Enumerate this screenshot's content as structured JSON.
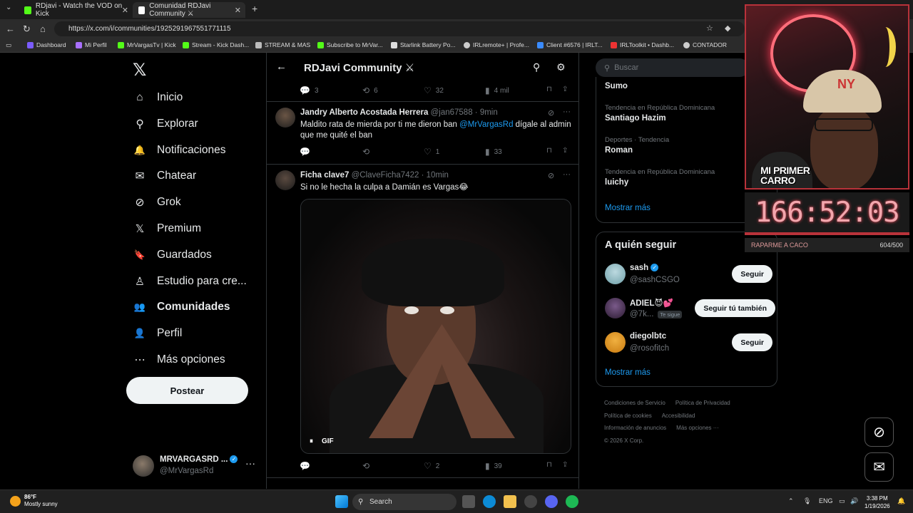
{
  "browser": {
    "tabs": [
      {
        "title": "RDjavi - Watch the VOD on Kick",
        "color": "#53fc18"
      },
      {
        "title": "Comunidad RDJavi Community ⚔",
        "color": "#ffffff"
      }
    ],
    "url": "https://x.com/i/communities/1925291967551771115",
    "bookmarks": [
      {
        "label": "Dashboard",
        "color": "#7b5cff"
      },
      {
        "label": "Mi Perfil",
        "color": "#a970ff"
      },
      {
        "label": "MrVargasTv | Kick",
        "color": "#53fc18"
      },
      {
        "label": "Stream - Kick Dash...",
        "color": "#53fc18"
      },
      {
        "label": "STREAM & MAS",
        "color": "#bbbbbb"
      },
      {
        "label": "Subscribe to MrVar...",
        "color": "#53fc18"
      },
      {
        "label": "Starlink Battery Po...",
        "color": "#dddddd"
      },
      {
        "label": "IRLremote+ | Profe...",
        "color": "#cccccc"
      },
      {
        "label": "Client #6576 | IRLT...",
        "color": "#3a8bff"
      },
      {
        "label": "IRLToolkit • Dashb...",
        "color": "#e33"
      },
      {
        "label": "CONTADOR",
        "color": "#cccccc"
      }
    ]
  },
  "sidebar": {
    "logo": "𝕏",
    "items": [
      {
        "label": "Inicio",
        "icon": "home-icon",
        "glyph": "⌂"
      },
      {
        "label": "Explorar",
        "icon": "search-icon",
        "glyph": "⚲"
      },
      {
        "label": "Notificaciones",
        "icon": "bell-icon",
        "glyph": "🔔"
      },
      {
        "label": "Chatear",
        "icon": "mail-icon",
        "glyph": "✉"
      },
      {
        "label": "Grok",
        "icon": "grok-icon",
        "glyph": "⊘"
      },
      {
        "label": "Premium",
        "icon": "x-icon",
        "glyph": "𝕏"
      },
      {
        "label": "Guardados",
        "icon": "bookmark-icon",
        "glyph": "🔖"
      },
      {
        "label": "Estudio para cre...",
        "icon": "studio-icon",
        "glyph": "♙"
      },
      {
        "label": "Comunidades",
        "icon": "communities-icon",
        "glyph": "👥"
      },
      {
        "label": "Perfil",
        "icon": "profile-icon",
        "glyph": "👤"
      },
      {
        "label": "Más opciones",
        "icon": "more-icon",
        "glyph": "⋯"
      }
    ],
    "post_button": "Postear",
    "account": {
      "name": "MRVARGASRD ...",
      "handle": "@MrVargasRd"
    }
  },
  "timeline": {
    "title": "RDJavi Community ⚔",
    "top_actions": {
      "replies": "3",
      "reposts": "6",
      "likes": "32",
      "views": "4 mil"
    },
    "posts": [
      {
        "name": "Jandry Alberto Acostada Herrera",
        "handle": "@jan67588",
        "time": "· 9min",
        "text_before": "Maldito rata de mierda por ti me dieron ban ",
        "mention": "@MrVargasRd",
        "text_after": " dígale al admin que me quité el ban",
        "replies": "",
        "reposts": "",
        "likes": "1",
        "views": "33"
      },
      {
        "name": "Ficha clave7",
        "handle": "@ClaveFicha7422",
        "time": "· 10min",
        "text": "Si no le hecha la culpa a Damián es Vargas😂",
        "media_label": "GIF",
        "replies": "",
        "reposts": "",
        "likes": "2",
        "views": "39"
      }
    ]
  },
  "right": {
    "search_placeholder": "Buscar",
    "trends": [
      {
        "category": "",
        "name": "Sumo"
      },
      {
        "category": "Tendencia en República Dominicana",
        "name": "Santiago Hazim"
      },
      {
        "category": "Deportes · Tendencia",
        "name": "Roman"
      },
      {
        "category": "Tendencia en República Dominicana",
        "name": "luichy"
      }
    ],
    "show_more": "Mostrar más",
    "who_to_follow": {
      "title": "A quién seguir",
      "users": [
        {
          "name": "sash",
          "handle": "@sashCSGO",
          "button": "Seguir",
          "verified": true,
          "badge": ""
        },
        {
          "name": "ADIEL😈💕",
          "handle": "@7k...",
          "button": "Seguir tú también",
          "verified": false,
          "badge": "Te sigue"
        },
        {
          "name": "diegolbtc",
          "handle": "@rosofitch",
          "button": "Seguir",
          "verified": false,
          "badge": ""
        }
      ],
      "show_more": "Mostrar más"
    },
    "footer": [
      "Condiciones de Servicio",
      "Política de Privacidad",
      "Política de cookies",
      "Accesibilidad",
      "Información de anuncios",
      "Más opciones ···",
      "© 2026 X Corp."
    ]
  },
  "overlay": {
    "cam_label_line1": "MI PRIMER",
    "cam_label_line2": "CARRO",
    "timer": "166:52:03",
    "goal_label": "RAPARME A CACO",
    "goal_count": "604/500"
  },
  "taskbar": {
    "temp": "86°F",
    "weather": "Mostly sunny",
    "search": "Search",
    "lang": "ENG",
    "time": "3:38 PM",
    "date": "1/19/2026"
  }
}
